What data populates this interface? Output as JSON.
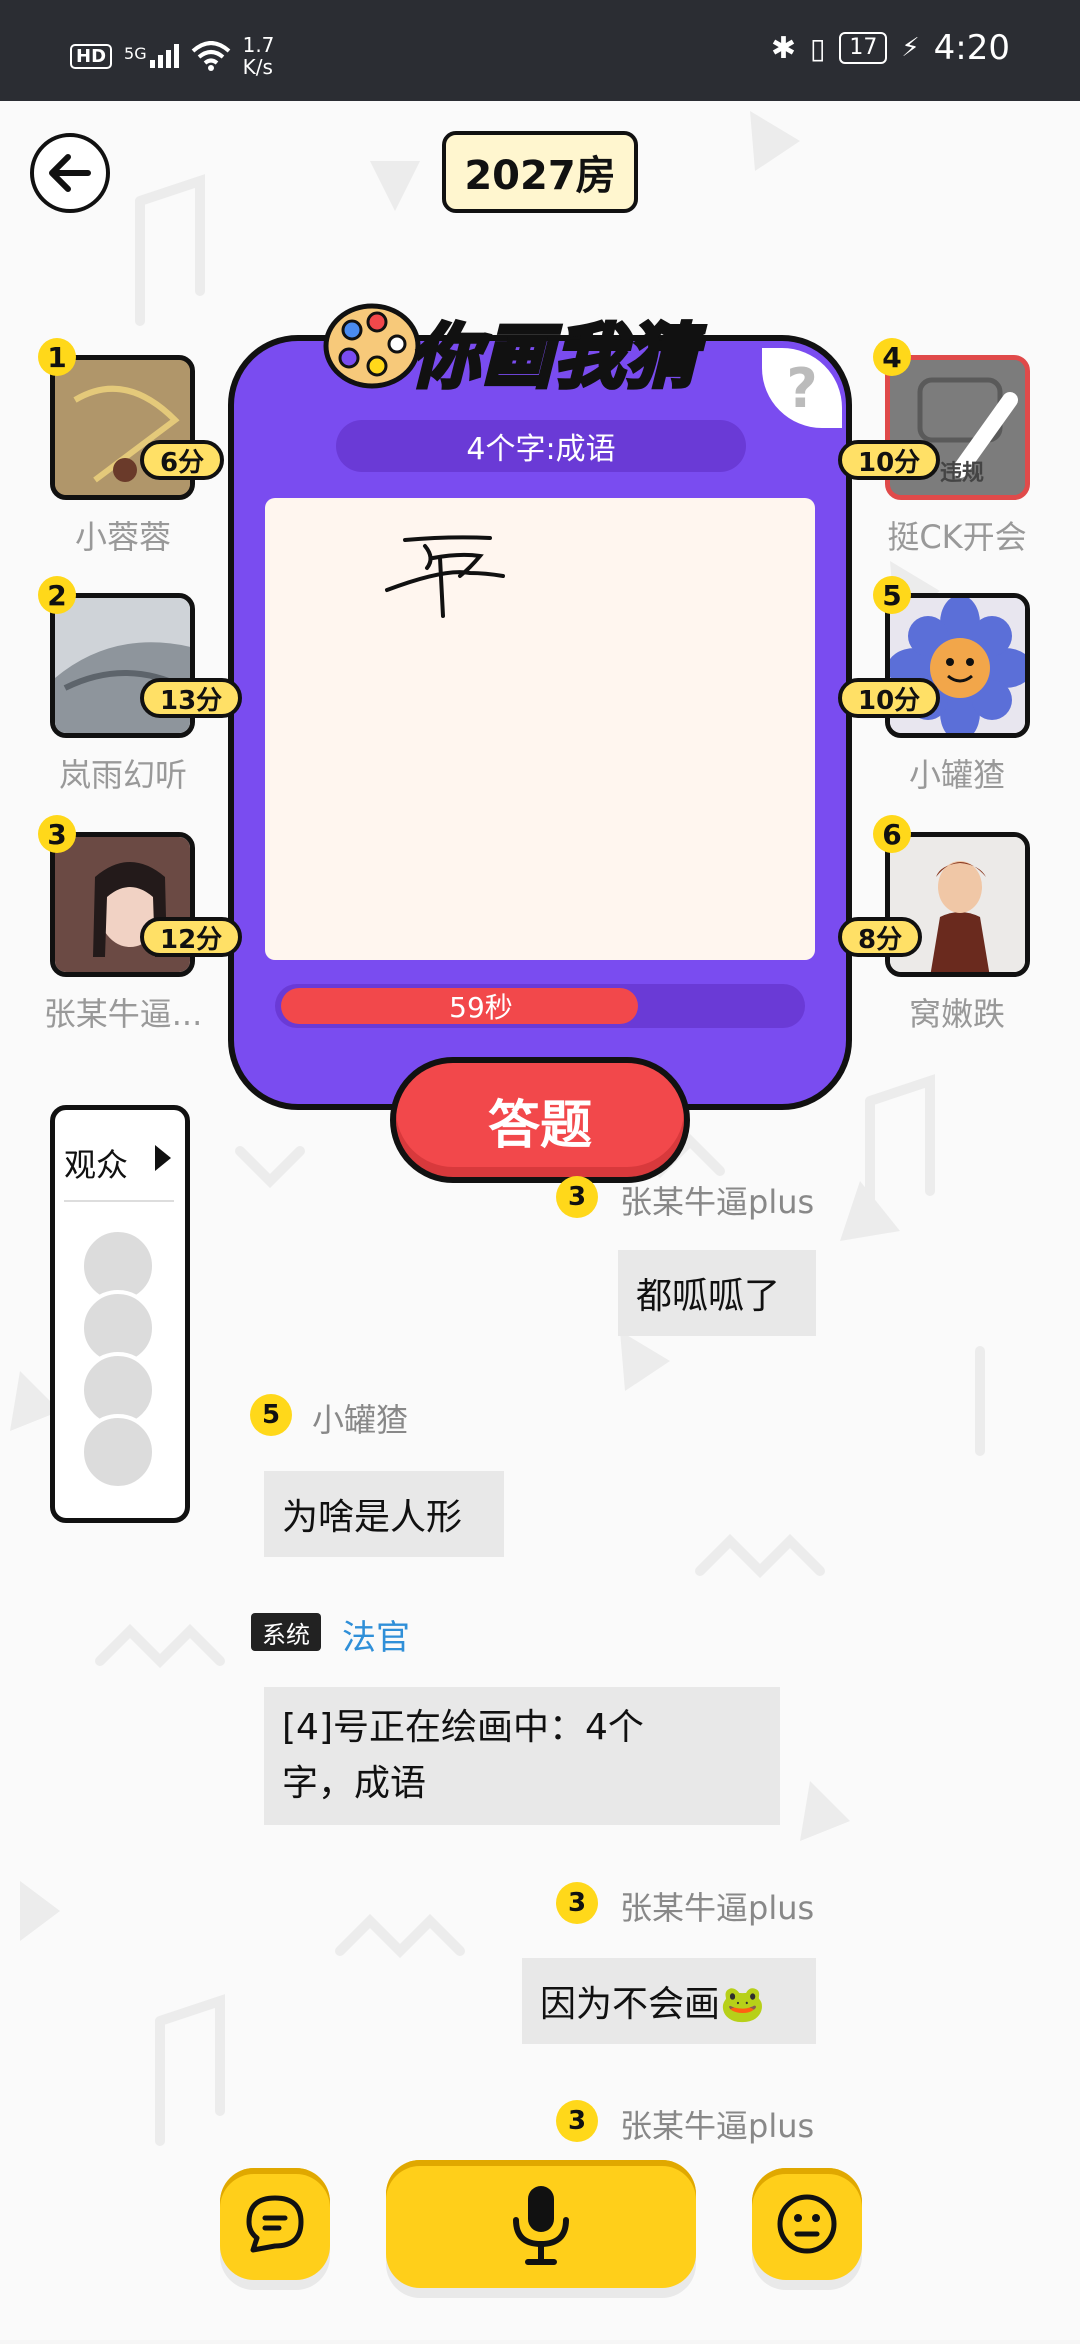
{
  "status_bar": {
    "hd": "HD",
    "signal": "5G",
    "speed_value": "1.7",
    "speed_unit": "K/s",
    "battery": "17",
    "time": "4:20"
  },
  "header": {
    "room": "2027房"
  },
  "game": {
    "title": "你画我猜",
    "help": "?",
    "hint": "4个字:成语",
    "timer_label": "59秒",
    "timer_fraction": 0.69,
    "answer_label": "答题"
  },
  "players_left": [
    {
      "seat": "1",
      "score": "6分",
      "name": "小蓉蓉"
    },
    {
      "seat": "2",
      "score": "13分",
      "name": "岚雨幻听"
    },
    {
      "seat": "3",
      "score": "12分",
      "name": "张某牛逼..."
    }
  ],
  "players_right": [
    {
      "seat": "4",
      "score": "10分",
      "name": "挺CK开会",
      "badge": "违规"
    },
    {
      "seat": "5",
      "score": "10分",
      "name": "小罐猹"
    },
    {
      "seat": "6",
      "score": "8分",
      "name": "窝嫩跌"
    }
  ],
  "audience": {
    "label": "观众"
  },
  "chat": [
    {
      "seat": "3",
      "name": "张某牛逼plus",
      "text": "都呱呱了"
    },
    {
      "seat": "5",
      "name": "小罐猹",
      "text": "为啥是人形"
    },
    {
      "tag": "系统",
      "name": "法官",
      "text_line1": "[4]号正在绘画中：4个",
      "text_line2": "字，成语"
    },
    {
      "seat": "3",
      "name": "张某牛逼plus",
      "text": "因为不会画🐸"
    },
    {
      "seat": "3",
      "name": "张某牛逼plus"
    }
  ],
  "colors": {
    "accent": "#7a4cf0",
    "red": "#f2484b",
    "yellow": "#ffd81a"
  }
}
